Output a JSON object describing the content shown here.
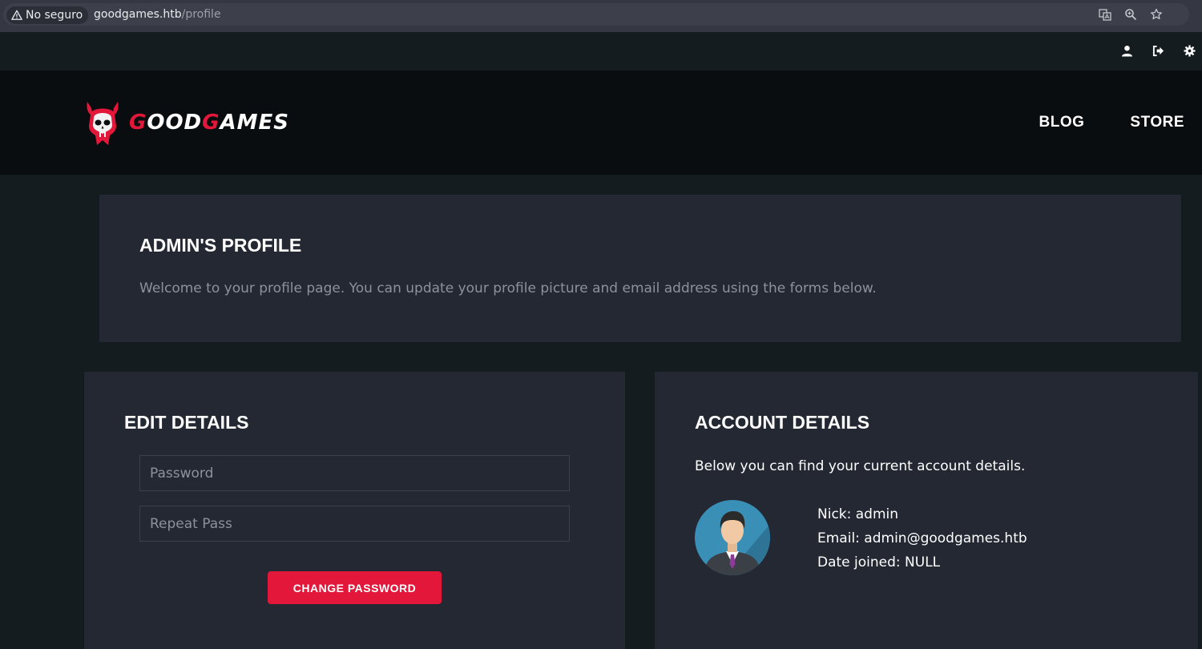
{
  "browser": {
    "security_label": "No seguro",
    "url_domain": "goodgames.htb",
    "url_path": "/profile",
    "icons": [
      "translate-icon",
      "zoom-icon",
      "bookmark-star-icon"
    ]
  },
  "topbar": {
    "icons": [
      "user-icon",
      "logout-icon",
      "settings-gear-icon"
    ]
  },
  "header": {
    "logo_text_g1": "G",
    "logo_text_mid": "OOD",
    "logo_text_g2": "G",
    "logo_text_end": "AMES",
    "nav": [
      "BLOG",
      "STORE"
    ]
  },
  "profile": {
    "title": "ADMIN'S PROFILE",
    "subtitle": "Welcome to your profile page. You can update your profile picture and email address using the forms below."
  },
  "edit": {
    "title": "EDIT DETAILS",
    "password_placeholder": "Password",
    "repeat_placeholder": "Repeat Pass",
    "button_label": "CHANGE PASSWORD"
  },
  "account": {
    "title": "ACCOUNT DETAILS",
    "subtitle": "Below you can find your current account details.",
    "nick": "Nick: admin",
    "email": "Email: admin@goodgames.htb",
    "date_joined": "Date joined: NULL"
  },
  "colors": {
    "accent": "#e3173a",
    "panel": "#232833",
    "background": "#151c20"
  }
}
